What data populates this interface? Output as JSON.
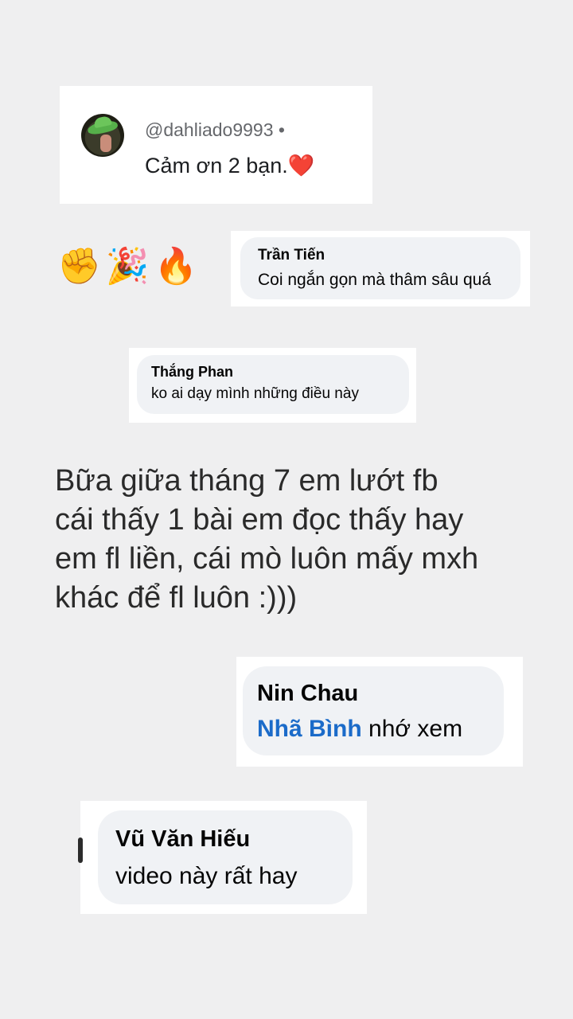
{
  "comment_1": {
    "handle": "@dahliado9993 •",
    "message": "Cảm ơn 2 bạn.❤️"
  },
  "reactions": {
    "emojis": "✊🎉🔥"
  },
  "comment_2": {
    "name": "Trần Tiến",
    "text": "Coi ngắn gọn mà thâm sâu quá"
  },
  "comment_3": {
    "name": "Thắng Phan",
    "text": "ko ai dạy mình những điều này"
  },
  "caption": {
    "lines": [
      "Bữa giữa tháng 7 em lướt fb",
      "cái thấy 1 bài em đọc thấy hay",
      "em fl liền, cái mò luôn mấy mxh",
      "khác để fl luôn :)))"
    ]
  },
  "comment_4": {
    "name": "Nin Chau",
    "mention": "Nhã Bình",
    "text": " nhớ xem",
    "mention_color": "#1b6bc9"
  },
  "comment_5": {
    "name": "Vũ Văn Hiếu",
    "text": "video này rất hay"
  },
  "colors": {
    "background": "#efeff0",
    "bubble": "#f0f2f5",
    "card": "#ffffff"
  }
}
